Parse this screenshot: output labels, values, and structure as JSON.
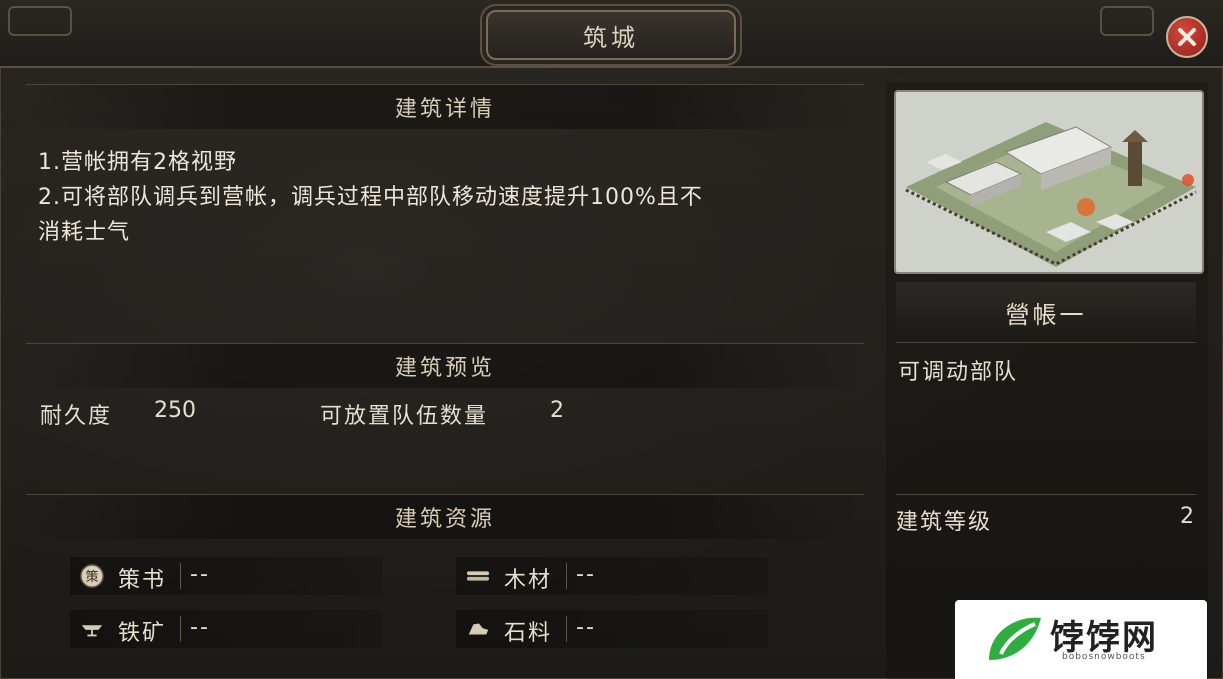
{
  "window": {
    "title": "筑城"
  },
  "sections": {
    "details": {
      "header": "建筑详情",
      "lines": [
        "1.营帐拥有2格视野",
        "2.可将部队调兵到营帐，调兵过程中部队移动速度提升100%且不",
        "消耗士气"
      ]
    },
    "preview": {
      "header": "建筑预览",
      "durability_label": "耐久度",
      "durability_value": "250",
      "capacity_label": "可放置队伍数量",
      "capacity_value": "2"
    },
    "resources": {
      "header": "建筑资源",
      "items": [
        {
          "name": "策书",
          "value": "--",
          "icon": "strategy-book-icon",
          "icon_glyph": "策"
        },
        {
          "name": "木材",
          "value": "--",
          "icon": "wood-icon"
        },
        {
          "name": "铁矿",
          "value": "--",
          "icon": "iron-ore-icon"
        },
        {
          "name": "石料",
          "value": "--",
          "icon": "stone-icon"
        }
      ]
    }
  },
  "side": {
    "building_name": "營帳一",
    "function_text": "可调动部队",
    "level_label": "建筑等级",
    "level_value": "2"
  },
  "watermark": {
    "text": "饽饽网",
    "subtext": "bobosnowboots"
  },
  "colors": {
    "close": "#c0392b",
    "panel": "#25221e",
    "text": "#e6dfcf"
  }
}
